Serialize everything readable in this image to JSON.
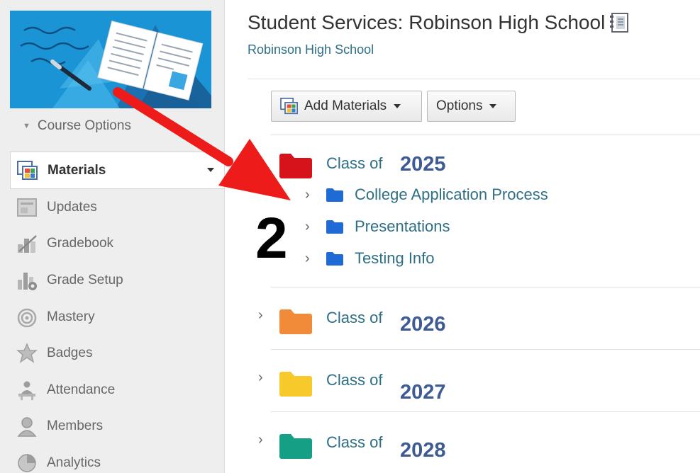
{
  "sidebar": {
    "course_options": "Course Options",
    "items": [
      {
        "label": "Materials",
        "icon": "materials-icon",
        "active": true
      },
      {
        "label": "Updates",
        "icon": "updates-icon"
      },
      {
        "label": "Gradebook",
        "icon": "gradebook-icon"
      },
      {
        "label": "Grade Setup",
        "icon": "grade-setup-icon"
      },
      {
        "label": "Mastery",
        "icon": "mastery-icon"
      },
      {
        "label": "Badges",
        "icon": "badges-icon"
      },
      {
        "label": "Attendance",
        "icon": "attendance-icon"
      },
      {
        "label": "Members",
        "icon": "members-icon"
      },
      {
        "label": "Analytics",
        "icon": "analytics-icon"
      }
    ]
  },
  "header": {
    "title": "Student Services: Robinson High School",
    "subtitle": "Robinson High School",
    "title_icon": "notebook-icon"
  },
  "toolbar": {
    "add_materials": "Add Materials",
    "options": "Options"
  },
  "folders": [
    {
      "label": "Class of",
      "year": "2025",
      "color": "#d6131b",
      "expanded": true,
      "children": [
        {
          "label": "College Application Process"
        },
        {
          "label": "Presentations"
        },
        {
          "label": "Testing Info"
        }
      ]
    },
    {
      "label": "Class of",
      "year": "2026",
      "color": "#f18b3a",
      "expanded": false
    },
    {
      "label": "Class of",
      "year": "2027",
      "color": "#f7c92b",
      "expanded": false
    },
    {
      "label": "Class of",
      "year": "2028",
      "color": "#15a085",
      "expanded": false
    }
  ],
  "annotation": {
    "step_number": "2",
    "arrow_color": "#ee1b1b"
  },
  "colors": {
    "link": "#2f6f85",
    "year": "#3e5b94",
    "subfolder": "#1f6bd6",
    "banner": "#1b94d6"
  }
}
